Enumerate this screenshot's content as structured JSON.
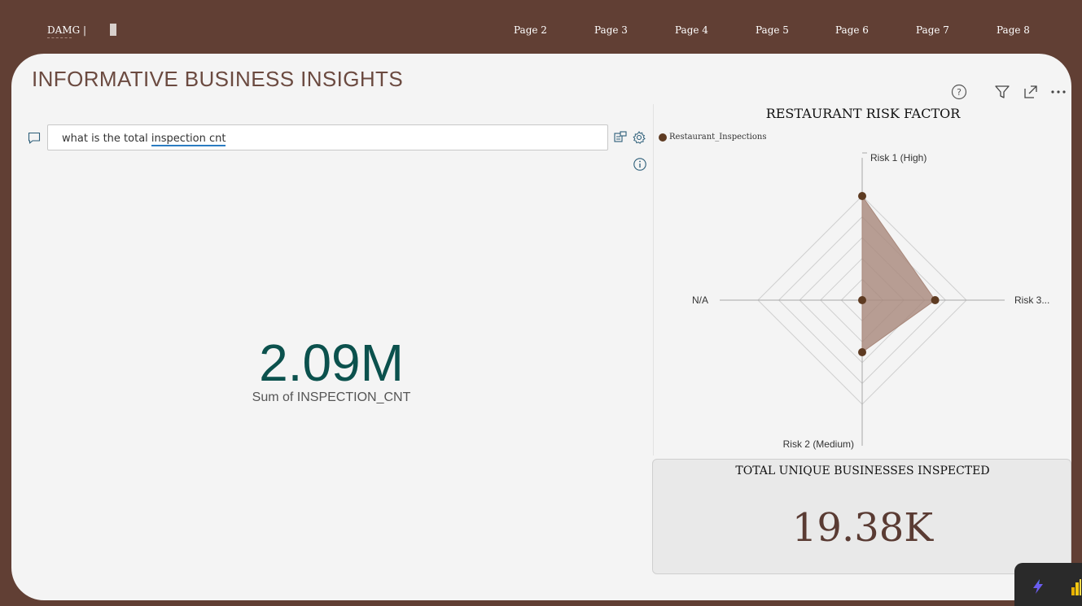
{
  "topnav": {
    "brand": "DAMG |",
    "pages": [
      "Page 2",
      "Page 3",
      "Page 4",
      "Page 5",
      "Page 6",
      "Page 7",
      "Page 8"
    ]
  },
  "page": {
    "title": "INFORMATIVE BUSINESS INSIGHTS"
  },
  "qa": {
    "query_prefix": "what is the total ",
    "query_highlight": "inspection cnt",
    "icons": [
      "chat-icon",
      "convert-icon",
      "settings-icon",
      "info-icon"
    ]
  },
  "kpi": {
    "value": "2.09M",
    "label": "Sum of INSPECTION_CNT"
  },
  "radar": {
    "title": "RESTAURANT RISK FACTOR",
    "legend": "Restaurant_Inspections",
    "colors": {
      "series": "#5e3b22",
      "fill": "#a8877a"
    }
  },
  "chart_data": {
    "type": "radar",
    "title": "RESTAURANT RISK FACTOR",
    "categories": [
      "Risk 1 (High)",
      "Risk 3...",
      "Risk 2 (Medium)",
      "N/A"
    ],
    "series": [
      {
        "name": "Restaurant_Inspections",
        "values": [
          1.0,
          0.7,
          0.5,
          0.0
        ]
      }
    ],
    "rmax": 1,
    "levels": 5,
    "legend": "top-left"
  },
  "unique": {
    "title": "TOTAL UNIQUE BUSINESSES INSPECTED",
    "value": "19.38K"
  },
  "header_icons": [
    "help-icon",
    "filter-icon",
    "focus-mode-icon",
    "more-options-icon"
  ],
  "tray_icons": [
    "copilot-icon",
    "power-bi-icon"
  ]
}
